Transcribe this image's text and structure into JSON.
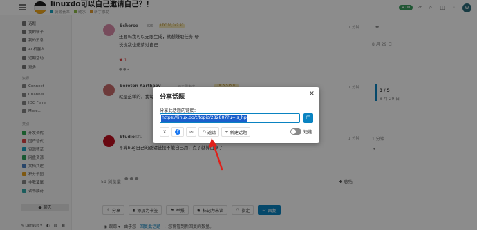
{
  "header": {
    "title": "linuxdo可以自己邀请自己？！",
    "categories": [
      "资源荟萃",
      "纯水",
      "新手求助"
    ],
    "unread_pill": "+10",
    "time_text": "2h",
    "user_initial": "W"
  },
  "sidebar": {
    "items": [
      {
        "label": "话题",
        "color": "#666"
      },
      {
        "label": "我的帖子",
        "color": "#666"
      },
      {
        "label": "我的消息",
        "color": "#666"
      },
      {
        "label": "AI 机器人",
        "color": "#666"
      },
      {
        "label": "近期活动",
        "color": "#666"
      },
      {
        "label": "更多",
        "color": "#666"
      }
    ],
    "resources_header": "资源",
    "resources": [
      {
        "label": "Connect"
      },
      {
        "label": "Channel"
      },
      {
        "label": "IDC Flare"
      },
      {
        "label": "More..."
      }
    ],
    "categories_header": "类别",
    "categories": [
      {
        "label": "开发调优",
        "color": "#32a852"
      },
      {
        "label": "国产替代",
        "color": "#d44"
      },
      {
        "label": "资源荟萃",
        "color": "#1aa3c0"
      },
      {
        "label": "网盘资源",
        "color": "#2aa05a"
      },
      {
        "label": "文档共建",
        "color": "#4a7fc0"
      },
      {
        "label": "积分乐园",
        "color": "#e5a020"
      },
      {
        "label": "非我莫属",
        "color": "#888"
      },
      {
        "label": "读书成诗",
        "color": "#3aa"
      }
    ],
    "chat_label": "聊天",
    "theme_label": "Default"
  },
  "posts": [
    {
      "user": "Scherse",
      "tag": "826",
      "badge": "LDC 10,342.87",
      "time": "1 分钟",
      "lines": [
        "还要吗我可以无限生成，就想赚取任务 😂",
        "说说我也邀请过自己"
      ]
    },
    {
      "user": "Seroton Karthaey",
      "tag": "还无限生成",
      "badge": "LDC 5,575.01",
      "time": "1 分钟",
      "lines": [
        "就是这样的，我每邀请一个新账号就可以用自己领取"
      ]
    },
    {
      "user": "Studio",
      "tag": "STU",
      "badge": "",
      "time": "1 分钟",
      "lines": [
        "不算bug自己的邀请链接不能自己用，点了就算白拿了"
      ]
    }
  ],
  "post_footer": {
    "views": "51 浏览量",
    "summary": "总结",
    "like_count": "1"
  },
  "actions": {
    "share": "分享",
    "bookmark": "添加为书签",
    "flag": "举报",
    "unread": "标记为未读",
    "assign": "指定",
    "reply": "回复"
  },
  "notification": {
    "label": "跟踪",
    "text_prefix": "由于您",
    "link": "回复此话题",
    "text_suffix": "，您将看到新回复的数量。"
  },
  "timeline": {
    "top_time": "8 月 29 日",
    "position": "3 / 5",
    "position_date": "8 月 29 日",
    "bottom_time": "1 分钟"
  },
  "modal": {
    "title": "分享话题",
    "link_label": "分享此话题的链接：",
    "link_value": "https://linux.do/t/topic/282807?u=is_hp",
    "buttons": {
      "x": "X",
      "facebook": "f",
      "email": "✉",
      "invite": "邀请",
      "new_topic": "新建话题"
    },
    "toggle_label": "短链"
  }
}
